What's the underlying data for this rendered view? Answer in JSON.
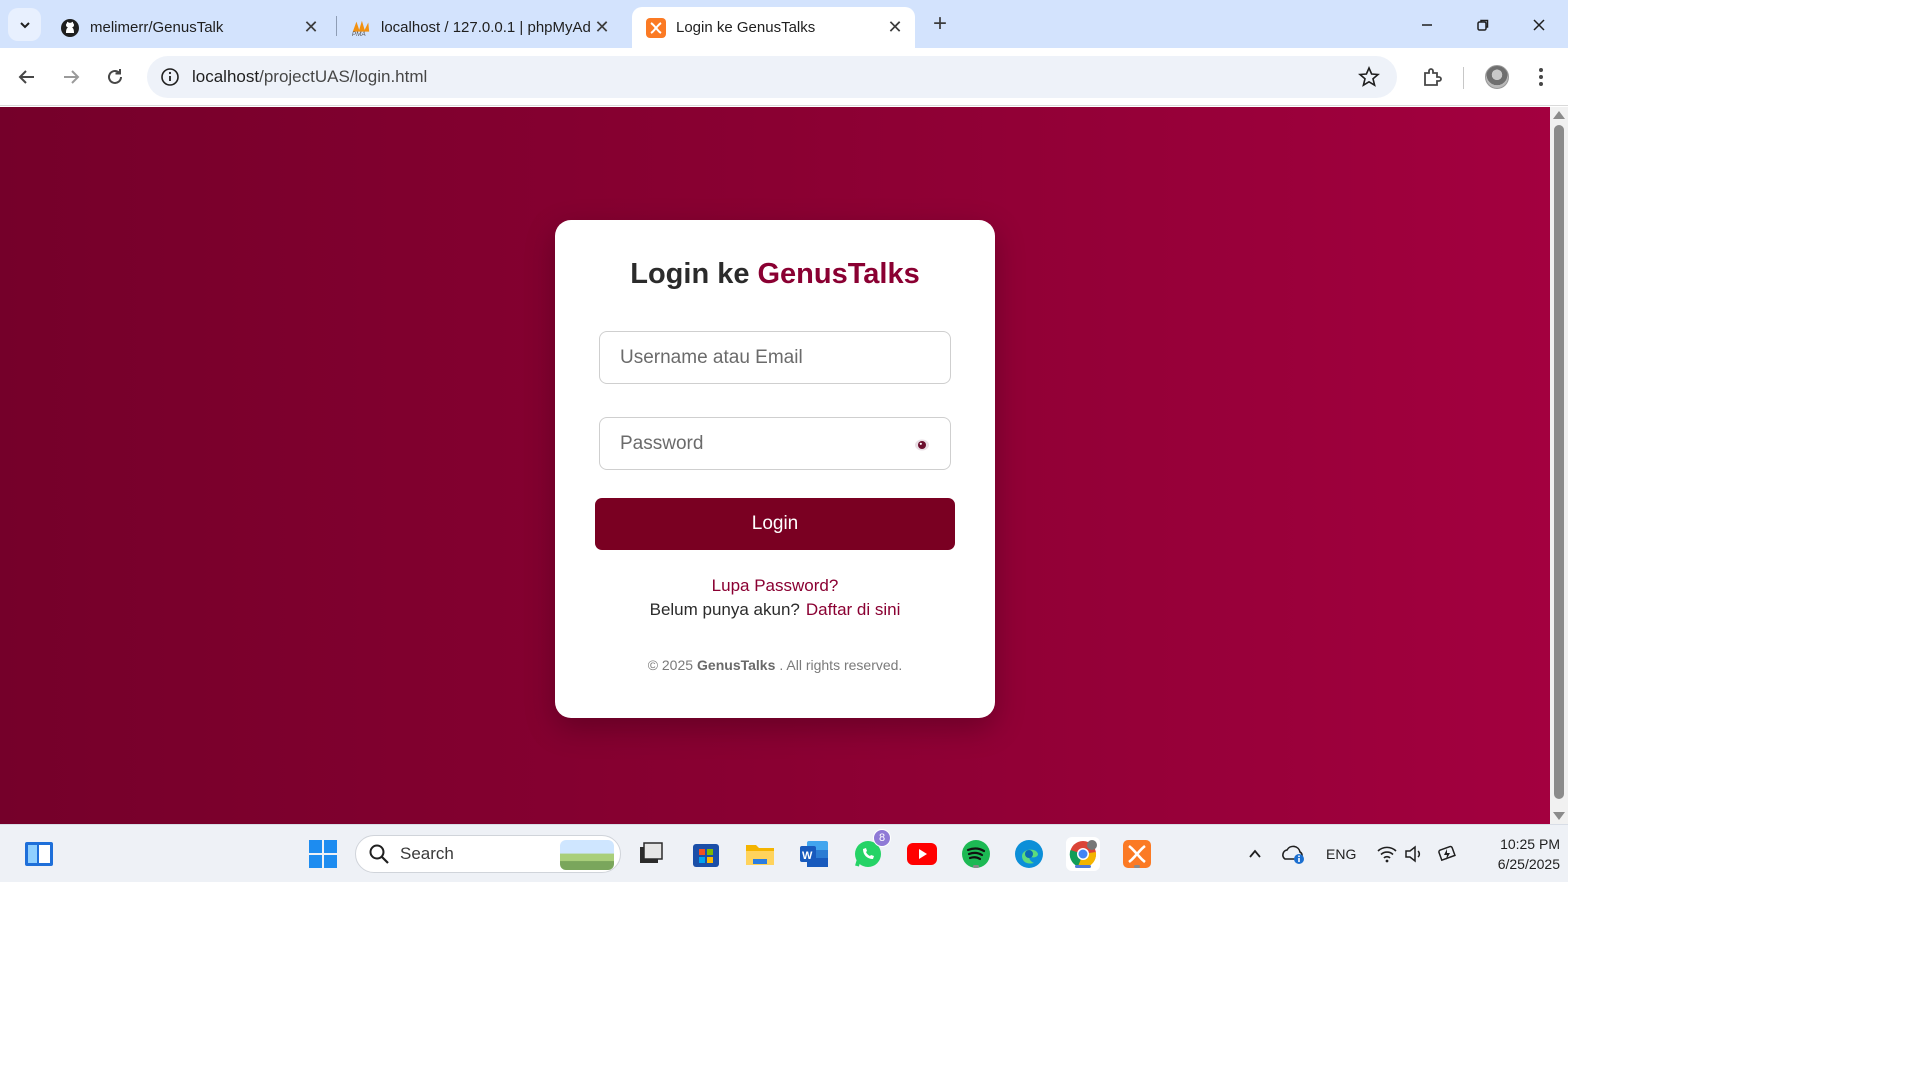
{
  "browser": {
    "tabs": [
      {
        "title": "melimerr/GenusTalk",
        "icon": "github-icon",
        "active": false
      },
      {
        "title": "localhost / 127.0.0.1 | phpMyAd",
        "icon": "phpmyadmin-icon",
        "active": false
      },
      {
        "title": "Login ke GenusTalks",
        "icon": "xampp-icon",
        "active": true
      }
    ],
    "url_host": "localhost",
    "url_path": "/projectUAS/login.html"
  },
  "page": {
    "title_prefix": "Login ke",
    "title_brand": "GenusTalks",
    "username_placeholder": "Username atau Email",
    "password_placeholder": "Password",
    "login_button": "Login",
    "forgot_link": "Lupa Password?",
    "register_prompt": "Belum punya akun?",
    "register_link": "Daftar di sini",
    "footer_prefix": "© 2025",
    "footer_brand": "GenusTalks",
    "footer_suffix": ". All rights reserved.",
    "colors": {
      "brand": "#8a0032",
      "button": "#7a0022",
      "background_start": "#75002a",
      "background_end": "#a3003f"
    }
  },
  "taskbar": {
    "search_label": "Search",
    "whatsapp_badge": "8",
    "language": "ENG",
    "time": "10:25 PM",
    "date": "6/25/2025"
  }
}
